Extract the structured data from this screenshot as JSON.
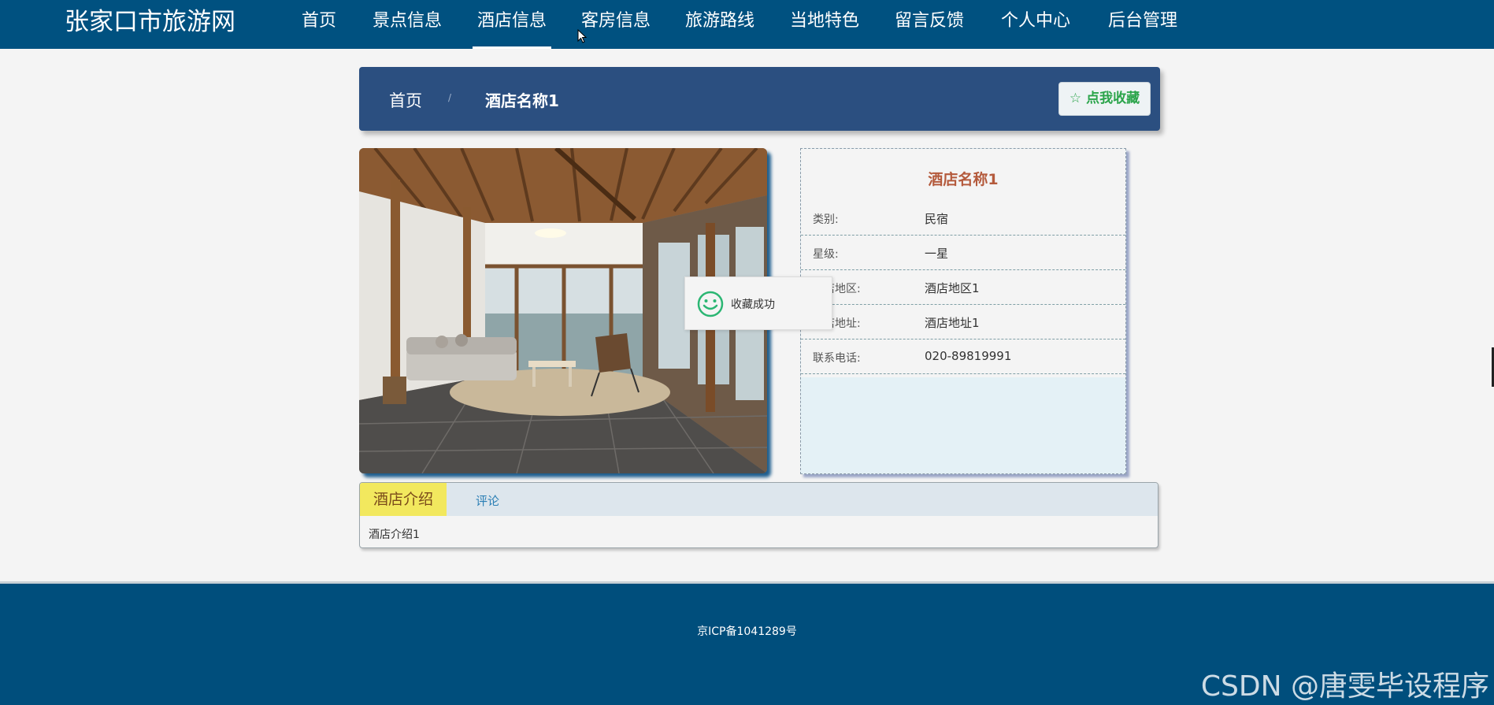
{
  "site": {
    "title": "张家口市旅游网"
  },
  "nav": {
    "items": [
      {
        "label": "首页",
        "active": false
      },
      {
        "label": "景点信息",
        "active": false
      },
      {
        "label": "酒店信息",
        "active": true
      },
      {
        "label": "客房信息",
        "active": false
      },
      {
        "label": "旅游路线",
        "active": false
      },
      {
        "label": "当地特色",
        "active": false
      },
      {
        "label": "留言反馈",
        "active": false
      },
      {
        "label": "个人中心",
        "active": false
      },
      {
        "label": "后台管理",
        "active": false
      }
    ]
  },
  "breadcrumb": {
    "home": "首页",
    "separator": "/",
    "current": "酒店名称1"
  },
  "favorite_button": {
    "label": "☆ 点我收藏"
  },
  "hotel": {
    "name": "酒店名称1",
    "fields": [
      {
        "label": "类别:",
        "value": "民宿"
      },
      {
        "label": "星级:",
        "value": "一星"
      },
      {
        "label": "酒店地区:",
        "value": "酒店地区1"
      },
      {
        "label": "酒店地址:",
        "value": "酒店地址1"
      },
      {
        "label": "联系电话:",
        "value": "020-89819991"
      }
    ]
  },
  "toast": {
    "message": "收藏成功",
    "icon": "smile-icon"
  },
  "tabs": {
    "items": [
      {
        "label": "酒店介绍",
        "active": true
      },
      {
        "label": "评论",
        "active": false
      }
    ],
    "content": "酒店介绍1"
  },
  "footer": {
    "icp": "京ICP备1041289号",
    "watermark": "CSDN @唐雯毕设程序"
  },
  "colors": {
    "nav_bg": "#005180",
    "crumb_bg": "#2b4f80",
    "hotel_name": "#b45a3c",
    "favorite_text": "#2aa44a",
    "tab_active_bg": "#f2e85e",
    "footer_bg": "#004e7c"
  }
}
